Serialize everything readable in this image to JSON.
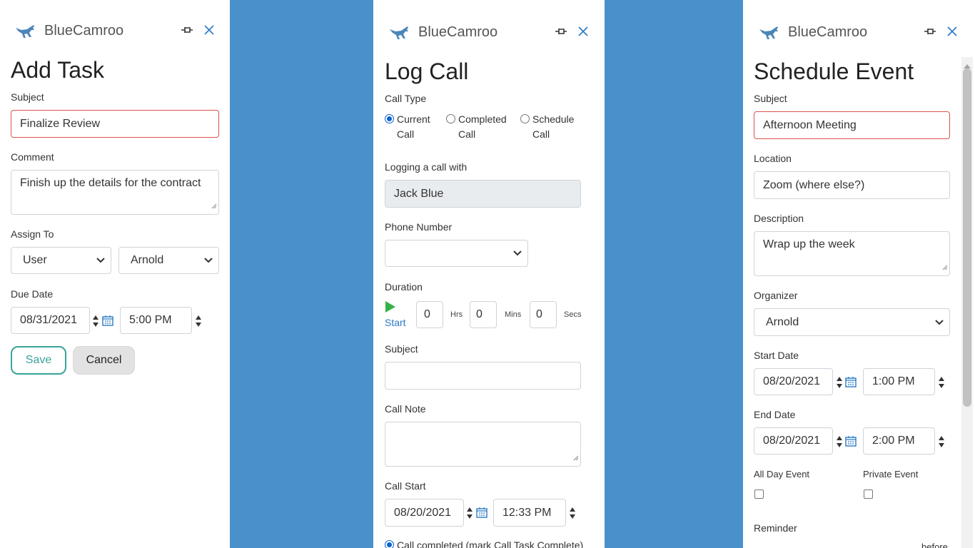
{
  "brand": {
    "name": "BlueCamroo",
    "logo_icon": "kangaroo-icon"
  },
  "icons": {
    "pin": "pin-icon",
    "close": "close-icon",
    "calendar": "calendar-icon",
    "spinner": "spinner-icon",
    "play": "play-icon"
  },
  "colors": {
    "background": "#4a90c9",
    "error_border": "#d9534f",
    "save_accent": "#3aa39a",
    "play_green": "#34b24a",
    "link_blue": "#2a7ac7"
  },
  "add_task": {
    "title": "Add Task",
    "subject_label": "Subject",
    "subject_value": "Finalize Review",
    "comment_label": "Comment",
    "comment_value": "Finish up the details for the contract",
    "assign_label": "Assign To",
    "assign_type": "User",
    "assign_user": "Arnold",
    "due_label": "Due Date",
    "due_date": "08/31/2021",
    "due_time": "5:00 PM",
    "save_label": "Save",
    "cancel_label": "Cancel"
  },
  "log_call": {
    "title": "Log Call",
    "call_type_label": "Call Type",
    "call_types": [
      {
        "line1": "Current",
        "line2": "Call",
        "selected": true
      },
      {
        "line1": "Completed",
        "line2": "Call",
        "selected": false
      },
      {
        "line1": "Schedule",
        "line2": "Call",
        "selected": false
      }
    ],
    "logging_label": "Logging a call with",
    "logging_value": "Jack Blue",
    "phone_label": "Phone Number",
    "phone_value": "",
    "duration_label": "Duration",
    "start_label": "Start",
    "hrs_value": "0",
    "hrs_label": "Hrs",
    "mins_value": "0",
    "mins_label": "Mins",
    "secs_value": "0",
    "secs_label": "Secs",
    "subject_label": "Subject",
    "subject_value": "",
    "note_label": "Call Note",
    "note_value": "",
    "call_start_label": "Call Start",
    "call_start_date": "08/20/2021",
    "call_start_time": "12:33 PM",
    "completed_option": "Call completed (mark Call Task Complete)"
  },
  "schedule_event": {
    "title": "Schedule Event",
    "subject_label": "Subject",
    "subject_value": "Afternoon Meeting",
    "location_label": "Location",
    "location_value": "Zoom (where else?)",
    "description_label": "Description",
    "description_value": "Wrap up the week",
    "organizer_label": "Organizer",
    "organizer_value": "Arnold",
    "start_label": "Start Date",
    "start_date": "08/20/2021",
    "start_time": "1:00 PM",
    "end_label": "End Date",
    "end_date": "08/20/2021",
    "end_time": "2:00 PM",
    "all_day_label": "All Day Event",
    "all_day_checked": false,
    "private_label": "Private Event",
    "private_checked": false,
    "reminder_label": "Reminder",
    "reminder_suffix": "before"
  }
}
